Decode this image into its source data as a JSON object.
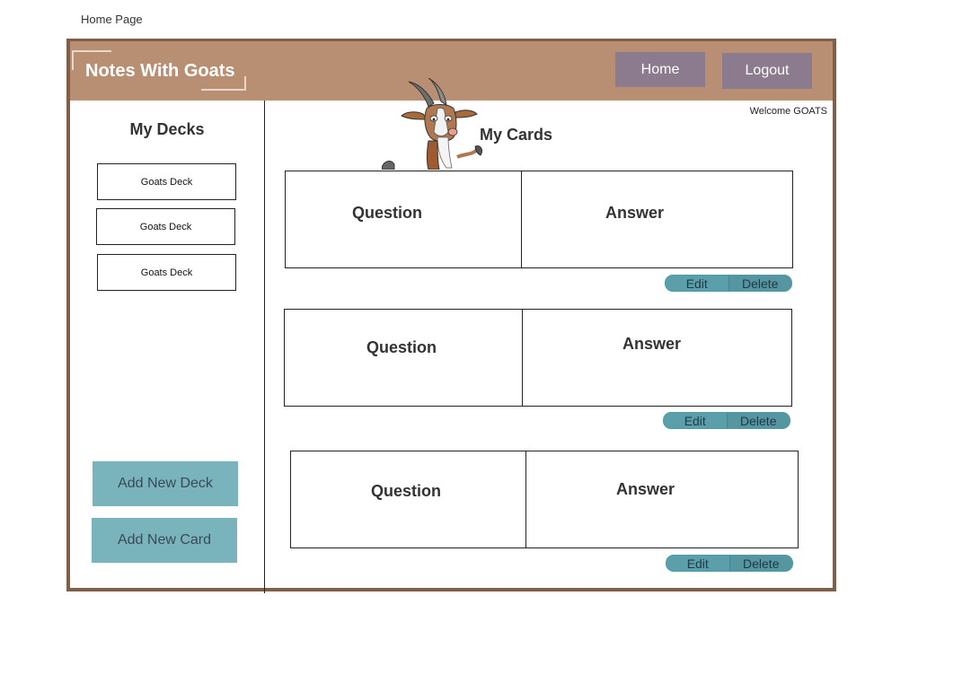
{
  "page": {
    "label": "Home Page"
  },
  "header": {
    "title": "Notes With Goats",
    "home_label": "Home",
    "logout_label": "Logout"
  },
  "sidebar": {
    "title": "My Decks",
    "decks": [
      {
        "label": "Goats Deck"
      },
      {
        "label": "Goats Deck"
      },
      {
        "label": "Goats Deck"
      }
    ],
    "add_deck_label": "Add New Deck",
    "add_card_label": "Add New Card"
  },
  "main": {
    "welcome": "Welcome GOATS",
    "title": "My Cards",
    "cards": [
      {
        "question": "Question",
        "answer": "Answer",
        "edit_label": "Edit",
        "delete_label": "Delete"
      },
      {
        "question": "Question",
        "answer": "Answer",
        "edit_label": "Edit",
        "delete_label": "Delete"
      },
      {
        "question": "Question",
        "answer": "Answer",
        "edit_label": "Edit",
        "delete_label": "Delete"
      }
    ]
  },
  "colors": {
    "header_bg": "#b88f72",
    "frame_border": "#7e5f4a",
    "nav_button": "#8c7b8e",
    "action_button": "#79b4bd",
    "pill_button": "#5a9fa9"
  },
  "icons": {
    "mascot": "goat-mascot-icon"
  }
}
